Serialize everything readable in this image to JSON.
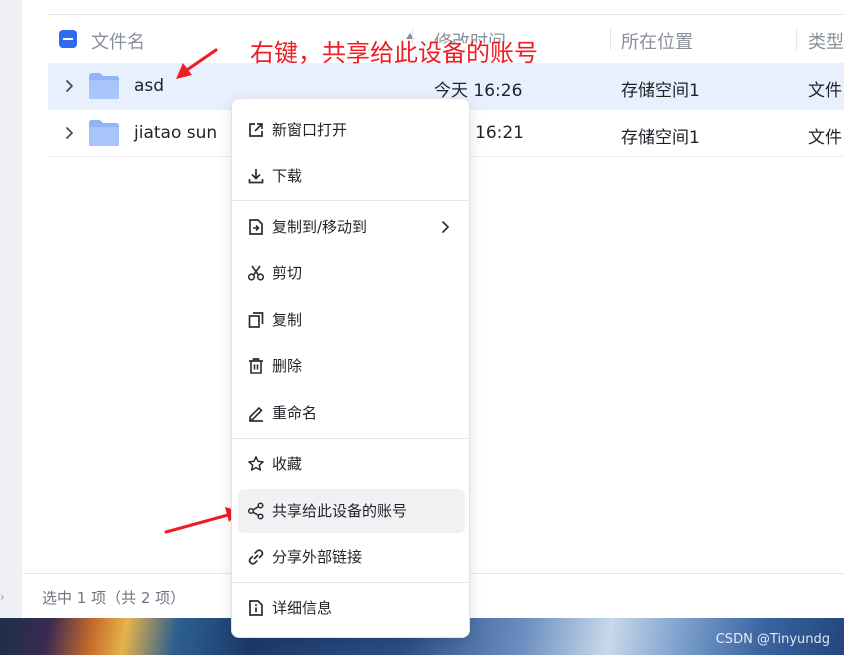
{
  "table": {
    "headers": {
      "name": "文件名",
      "modified": "修改时间",
      "location": "所在位置",
      "type": "类型"
    },
    "rows": [
      {
        "name": "asd",
        "modified": "今天 16:26",
        "location": "存储空间1",
        "type": "文件"
      },
      {
        "name": "jiatao sun",
        "modified": "16:21",
        "location": "存储空间1",
        "type": "文件"
      }
    ]
  },
  "annotation": {
    "text": "右键，共享给此设备的账号",
    "color": "#ee1d24"
  },
  "context_menu": {
    "items": [
      {
        "label": "新窗口打开",
        "icon": "open-new-window-icon"
      },
      {
        "label": "下载",
        "icon": "download-icon"
      },
      {
        "label": "复制到/移动到",
        "icon": "copy-move-icon",
        "has_submenu": true
      },
      {
        "label": "剪切",
        "icon": "scissors-icon"
      },
      {
        "label": "复制",
        "icon": "copy-icon"
      },
      {
        "label": "删除",
        "icon": "trash-icon"
      },
      {
        "label": "重命名",
        "icon": "pencil-icon"
      },
      {
        "label": "收藏",
        "icon": "star-icon"
      },
      {
        "label": "共享给此设备的账号",
        "icon": "share-icon",
        "highlighted": true
      },
      {
        "label": "分享外部链接",
        "icon": "link-icon"
      },
      {
        "label": "详细信息",
        "icon": "info-icon"
      }
    ]
  },
  "footer": {
    "status": "选中 1 项（共 2 项）",
    "watermark": "CSDN @Tinyundg"
  },
  "colors": {
    "accent": "#2d6cf0",
    "selected_row": "#e9f0fd",
    "folder": "#8fb4f7",
    "menu_hover": "#f0f1f3"
  }
}
